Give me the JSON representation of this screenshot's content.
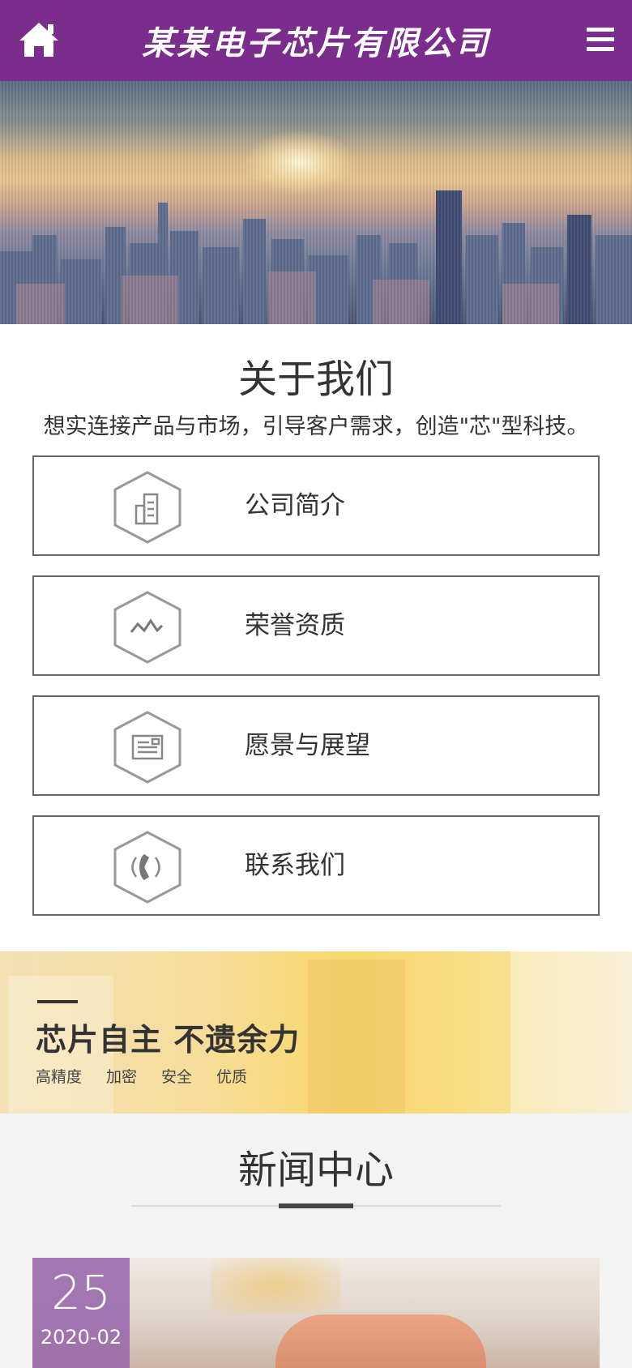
{
  "header": {
    "brand": "某某电子芯片有限公司",
    "home_icon": "home-icon",
    "menu_icon": "hamburger-menu-icon",
    "background": "#7b2d8e"
  },
  "about": {
    "title": "关于我们",
    "subtitle": "想实连接产品与市场，引导客户需求，创造\"芯\"型科技。",
    "cards": [
      {
        "label": "公司简介",
        "icon": "building-icon"
      },
      {
        "label": "荣誉资质",
        "icon": "wave-icon"
      },
      {
        "label": "愿景与展望",
        "icon": "document-icon"
      },
      {
        "label": "联系我们",
        "icon": "phone-icon"
      }
    ]
  },
  "promo": {
    "slogan": "芯片自主 不遗余力",
    "tags": [
      "高精度",
      "加密",
      "安全",
      "优质"
    ]
  },
  "news": {
    "title": "新闻中心",
    "first_item": {
      "day": "25",
      "year_month": "2020-02"
    }
  }
}
